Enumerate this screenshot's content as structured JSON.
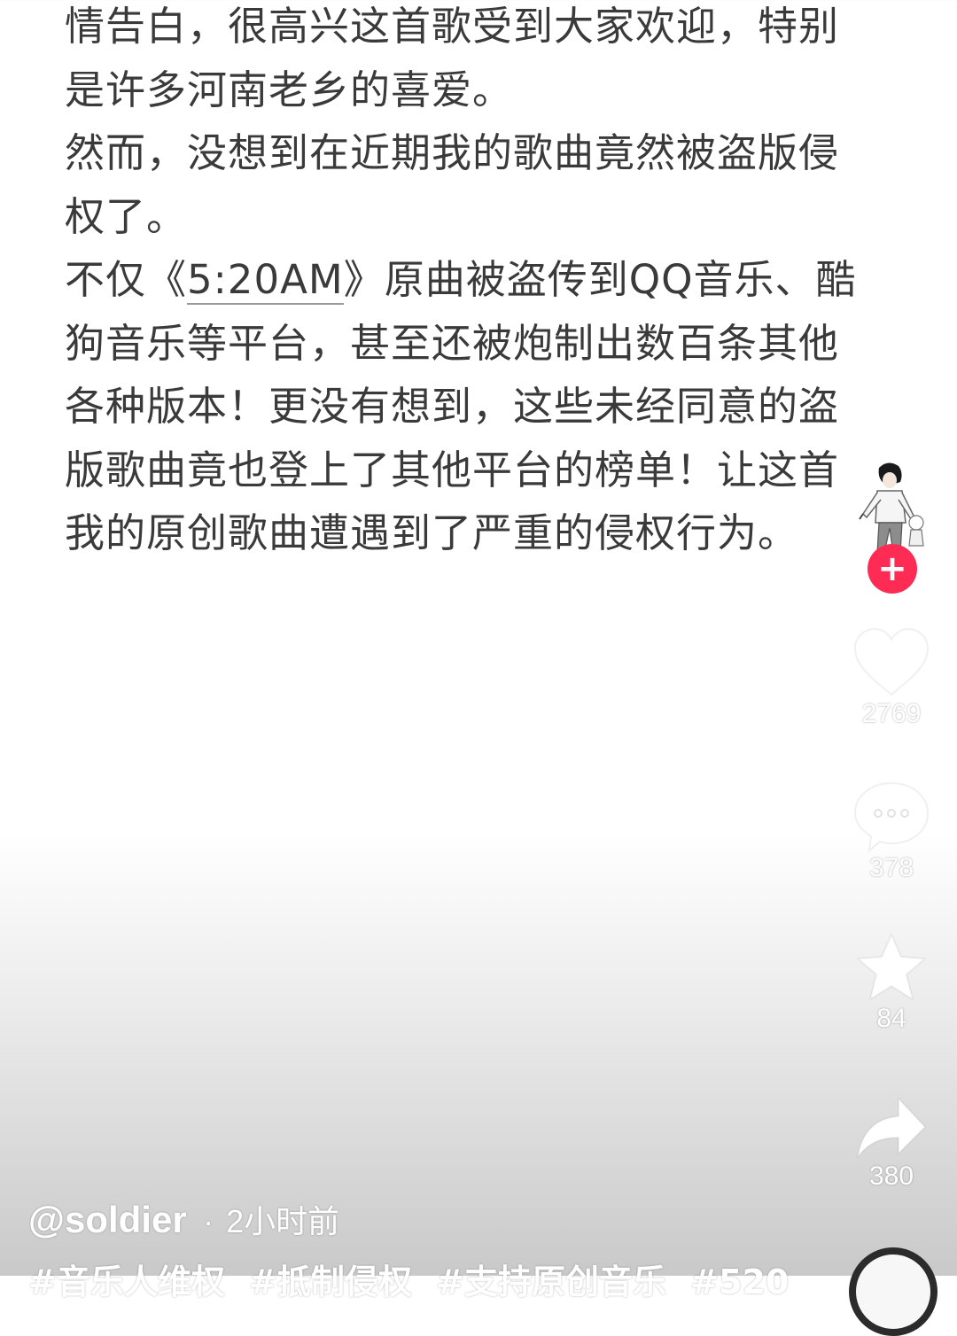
{
  "article": {
    "paragraphs": [
      {
        "before": "情告白，很高兴这首歌受到大家欢迎，特别是许多河南老乡的喜爱。"
      },
      {
        "before": "然而，没想到在近期我的歌曲竟然被盗版侵权了。"
      },
      {
        "before": "不仅《",
        "link": "5:20AM",
        "after": "》原曲被盗传到QQ音乐、酷狗音乐等平台，甚至还被炮制出数百条其他各种版本！更没有想到，这些未经同意的盗版歌曲竟也登上了其他平台的榜单！让这首我的原创歌曲遭遇到了严重的侵权行为。"
      }
    ]
  },
  "actions": {
    "likes": "2769",
    "comments": "378",
    "favorites": "84",
    "shares": "380"
  },
  "author": {
    "name": "@soldier",
    "separator": "·",
    "time": "2小时前"
  },
  "hashtags": [
    "#音乐人维权",
    "#抵制侵权",
    "#支持原创音乐",
    "#520"
  ],
  "icons": {
    "like": "heart-icon",
    "comment": "comment-bubble-icon",
    "favorite": "star-icon",
    "share": "share-arrow-icon",
    "follow": "plus-icon"
  },
  "colors": {
    "follow_button": "#fe2c55",
    "text": "#3a3a3a"
  }
}
